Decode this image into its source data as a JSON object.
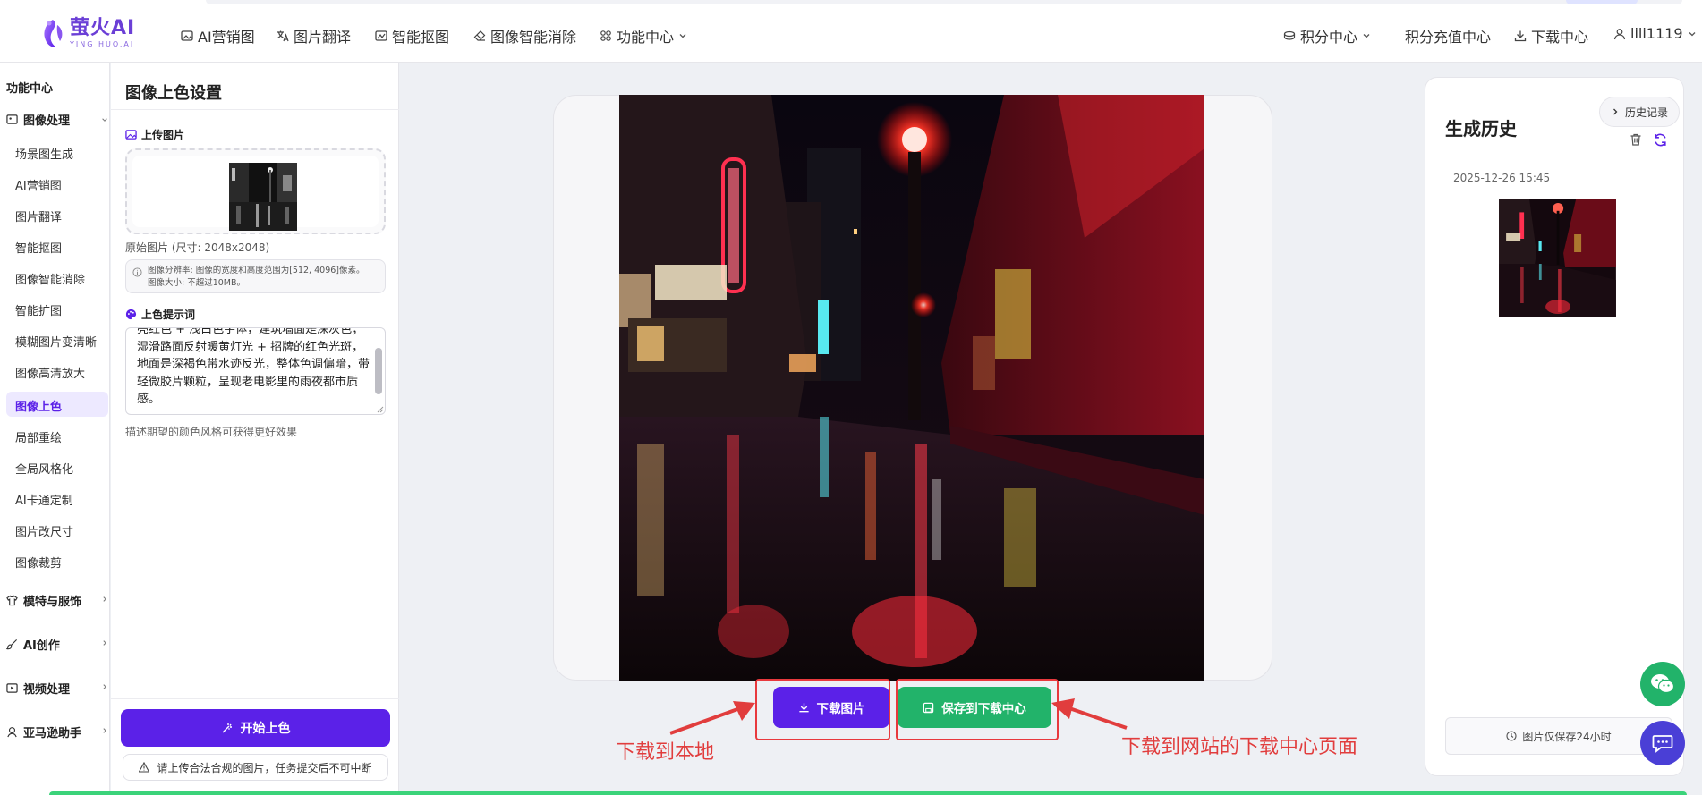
{
  "brand": {
    "name": "萤火AI",
    "sub": "YING HUO.AI",
    "accent": "#6b3fd6"
  },
  "topnav": {
    "items": [
      {
        "label": "AI营销图",
        "icon": "image-icon"
      },
      {
        "label": "图片翻译",
        "icon": "translate-icon"
      },
      {
        "label": "智能抠图",
        "icon": "cutout-icon"
      },
      {
        "label": "图像智能消除",
        "icon": "eraser-icon"
      },
      {
        "label": "功能中心",
        "icon": "grid-icon"
      }
    ],
    "right": {
      "points": "积分中心",
      "recharge": "积分充值中心",
      "downloads": "下载中心",
      "user": "lili1119"
    }
  },
  "sidebar": {
    "title": "功能中心",
    "group_image": "图像处理",
    "items": [
      "场景图生成",
      "AI营销图",
      "图片翻译",
      "智能抠图",
      "图像智能消除",
      "智能扩图",
      "模糊图片变清晰",
      "图像高清放大",
      "图像上色",
      "局部重绘",
      "全局风格化",
      "AI卡通定制",
      "图片改尺寸",
      "图像裁剪"
    ],
    "active": "图像上色",
    "groups": [
      "模特与服饰",
      "AI创作",
      "视频处理",
      "亚马逊助手"
    ]
  },
  "settings": {
    "title": "图像上色设置",
    "upload_label": "上传图片",
    "original_info": "原始图片 (尺寸: 2048x2048)",
    "tip_line1": "图像分辨率: 图像的宽度和高度范围为[512, 4096]像素。",
    "tip_line2": "图像大小: 不超过10MB。",
    "prompt_label": "上色提示词",
    "prompt_text": "亮红色 + 浅白色字体，建筑墙面是深灰色；湿滑路面反射暖黄灯光 + 招牌的红色光斑，地面是深褐色带水迹反光，整体色调偏暗，带轻微胶片颗粒，呈现老电影里的雨夜都市质感。",
    "hint": "描述期望的颜色风格可获得更好效果",
    "start_button": "开始上色",
    "legal_note": "请上传合法合规的图片，任务提交后不可中断"
  },
  "result": {
    "download_button": "下载图片",
    "save_button": "保存到下载中心",
    "annotation_left": "下载到本地",
    "annotation_right": "下载到网站的下载中心页面"
  },
  "history": {
    "button": "历史记录",
    "title": "生成历史",
    "date": "2025-12-26 15:45",
    "keep_note": "图片仅保存24小时"
  },
  "colors": {
    "primary": "#5b21e8",
    "success": "#22b36a",
    "annotation": "#e13d3d"
  }
}
